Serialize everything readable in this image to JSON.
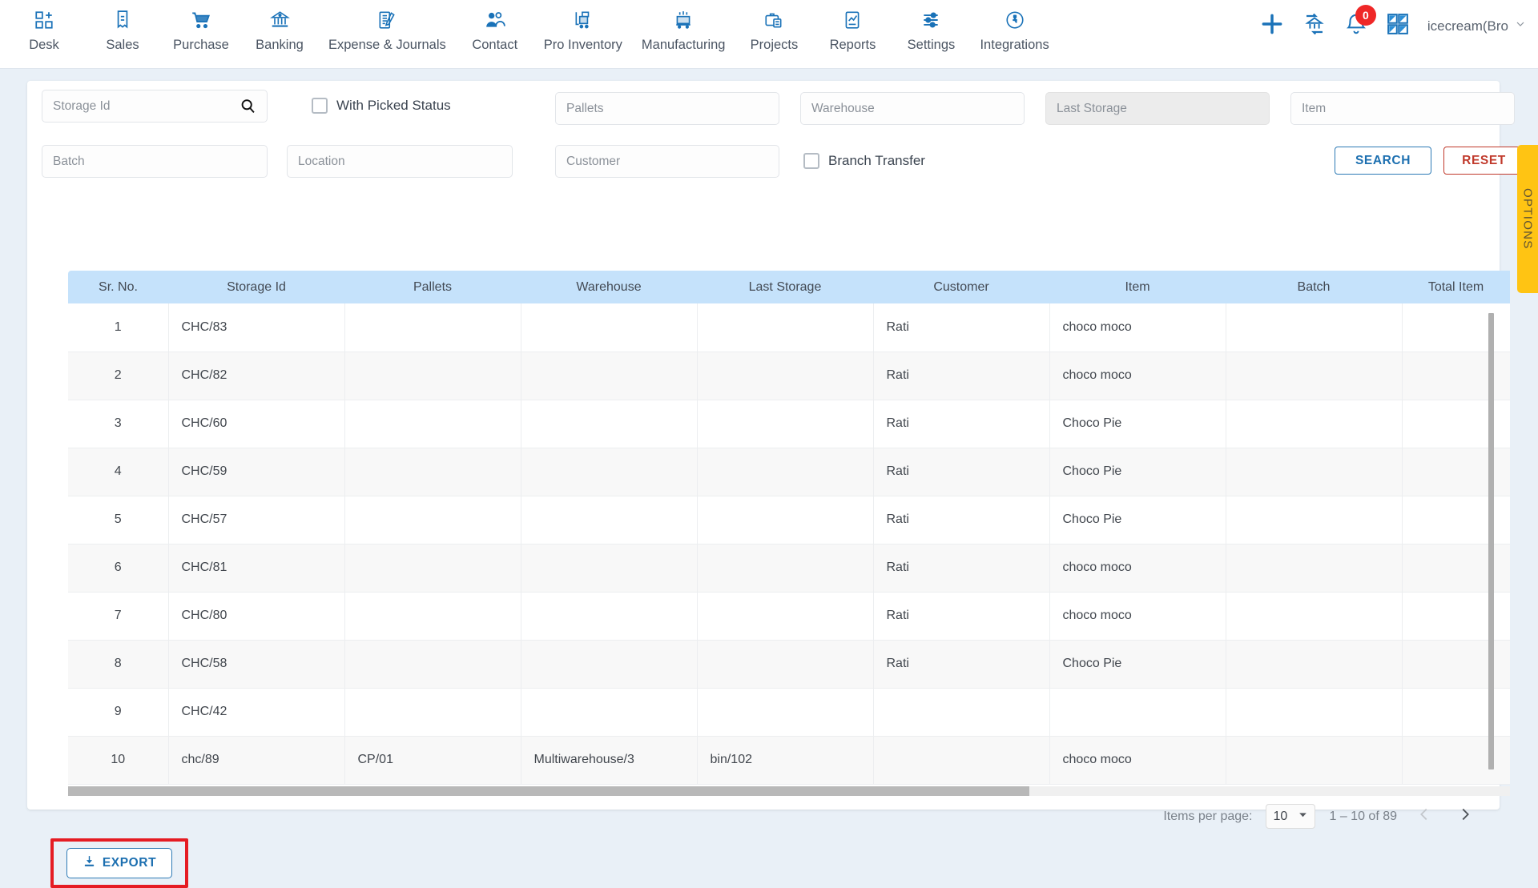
{
  "nav": {
    "items": [
      {
        "label": "Desk",
        "icon": "desk-icon"
      },
      {
        "label": "Sales",
        "icon": "receipt-icon"
      },
      {
        "label": "Purchase",
        "icon": "cart-icon"
      },
      {
        "label": "Banking",
        "icon": "bank-icon"
      },
      {
        "label": "Expense & Journals",
        "icon": "journal-icon"
      },
      {
        "label": "Contact",
        "icon": "contacts-icon"
      },
      {
        "label": "Pro Inventory",
        "icon": "inventory-icon"
      },
      {
        "label": "Manufacturing",
        "icon": "manufacturing-icon"
      },
      {
        "label": "Projects",
        "icon": "briefcase-icon"
      },
      {
        "label": "Reports",
        "icon": "report-icon"
      },
      {
        "label": "Settings",
        "icon": "sliders-icon"
      },
      {
        "label": "Integrations",
        "icon": "plug-icon"
      }
    ],
    "right": {
      "add_icon": "plus-icon",
      "transfer_icon": "bank-transfer-icon",
      "bell_icon": "bell-icon",
      "notification_count": "0",
      "apps_icon": "apps-grid-icon",
      "user_label": "icecream(Bro",
      "user_chevron": "chevron-down-icon"
    }
  },
  "filters": {
    "storage_id": {
      "placeholder": "Storage Id",
      "value": "",
      "icon": "search-icon"
    },
    "with_picked_status": {
      "label": "With Picked Status",
      "checked": false
    },
    "pallets": {
      "placeholder": "Pallets",
      "value": ""
    },
    "warehouse": {
      "placeholder": "Warehouse",
      "value": ""
    },
    "last_storage": {
      "placeholder": "Last Storage",
      "value": "",
      "disabled": true
    },
    "item": {
      "placeholder": "Item",
      "value": ""
    },
    "batch": {
      "placeholder": "Batch",
      "value": ""
    },
    "location": {
      "placeholder": "Location",
      "value": ""
    },
    "customer": {
      "placeholder": "Customer",
      "value": ""
    },
    "branch_transfer": {
      "label": "Branch Transfer",
      "checked": false
    },
    "search_label": "SEARCH",
    "reset_label": "RESET"
  },
  "table": {
    "columns": [
      "Sr. No.",
      "Storage Id",
      "Pallets",
      "Warehouse",
      "Last Storage",
      "Customer",
      "Item",
      "Batch",
      "Total Item"
    ],
    "rows": [
      {
        "sr": "1",
        "storage_id": "CHC/83",
        "pallets": "",
        "warehouse": "",
        "last_storage": "",
        "customer": "Rati",
        "item": "choco moco",
        "batch": "",
        "total_item": ""
      },
      {
        "sr": "2",
        "storage_id": "CHC/82",
        "pallets": "",
        "warehouse": "",
        "last_storage": "",
        "customer": "Rati",
        "item": "choco moco",
        "batch": "",
        "total_item": ""
      },
      {
        "sr": "3",
        "storage_id": "CHC/60",
        "pallets": "",
        "warehouse": "",
        "last_storage": "",
        "customer": "Rati",
        "item": "Choco Pie",
        "batch": "",
        "total_item": ""
      },
      {
        "sr": "4",
        "storage_id": "CHC/59",
        "pallets": "",
        "warehouse": "",
        "last_storage": "",
        "customer": "Rati",
        "item": "Choco Pie",
        "batch": "",
        "total_item": ""
      },
      {
        "sr": "5",
        "storage_id": "CHC/57",
        "pallets": "",
        "warehouse": "",
        "last_storage": "",
        "customer": "Rati",
        "item": "Choco Pie",
        "batch": "",
        "total_item": ""
      },
      {
        "sr": "6",
        "storage_id": "CHC/81",
        "pallets": "",
        "warehouse": "",
        "last_storage": "",
        "customer": "Rati",
        "item": "choco moco",
        "batch": "",
        "total_item": ""
      },
      {
        "sr": "7",
        "storage_id": "CHC/80",
        "pallets": "",
        "warehouse": "",
        "last_storage": "",
        "customer": "Rati",
        "item": "choco moco",
        "batch": "",
        "total_item": ""
      },
      {
        "sr": "8",
        "storage_id": "CHC/58",
        "pallets": "",
        "warehouse": "",
        "last_storage": "",
        "customer": "Rati",
        "item": "Choco Pie",
        "batch": "",
        "total_item": ""
      },
      {
        "sr": "9",
        "storage_id": "CHC/42",
        "pallets": "",
        "warehouse": "",
        "last_storage": "",
        "customer": "",
        "item": "",
        "batch": "",
        "total_item": ""
      },
      {
        "sr": "10",
        "storage_id": "chc/89",
        "pallets": "CP/01",
        "warehouse": "Multiwarehouse/3",
        "last_storage": "bin/102",
        "customer": "",
        "item": "choco moco",
        "batch": "",
        "total_item": ""
      }
    ]
  },
  "paginator": {
    "items_per_page_label": "Items per page:",
    "items_per_page_value": "10",
    "range_label": "1 – 10 of 89",
    "prev_icon": "chevron-left-icon",
    "next_icon": "chevron-right-icon"
  },
  "export": {
    "label": "EXPORT",
    "icon": "download-icon"
  },
  "options_tab": {
    "label": "OPTIONS"
  },
  "colors": {
    "accent_blue": "#1c6fb0",
    "reset_red": "#c0392b",
    "header_blue": "#c5e2fb",
    "highlight_red": "#e51c23",
    "options_yellow": "#ffc413",
    "page_bg": "#e9f0f7"
  }
}
